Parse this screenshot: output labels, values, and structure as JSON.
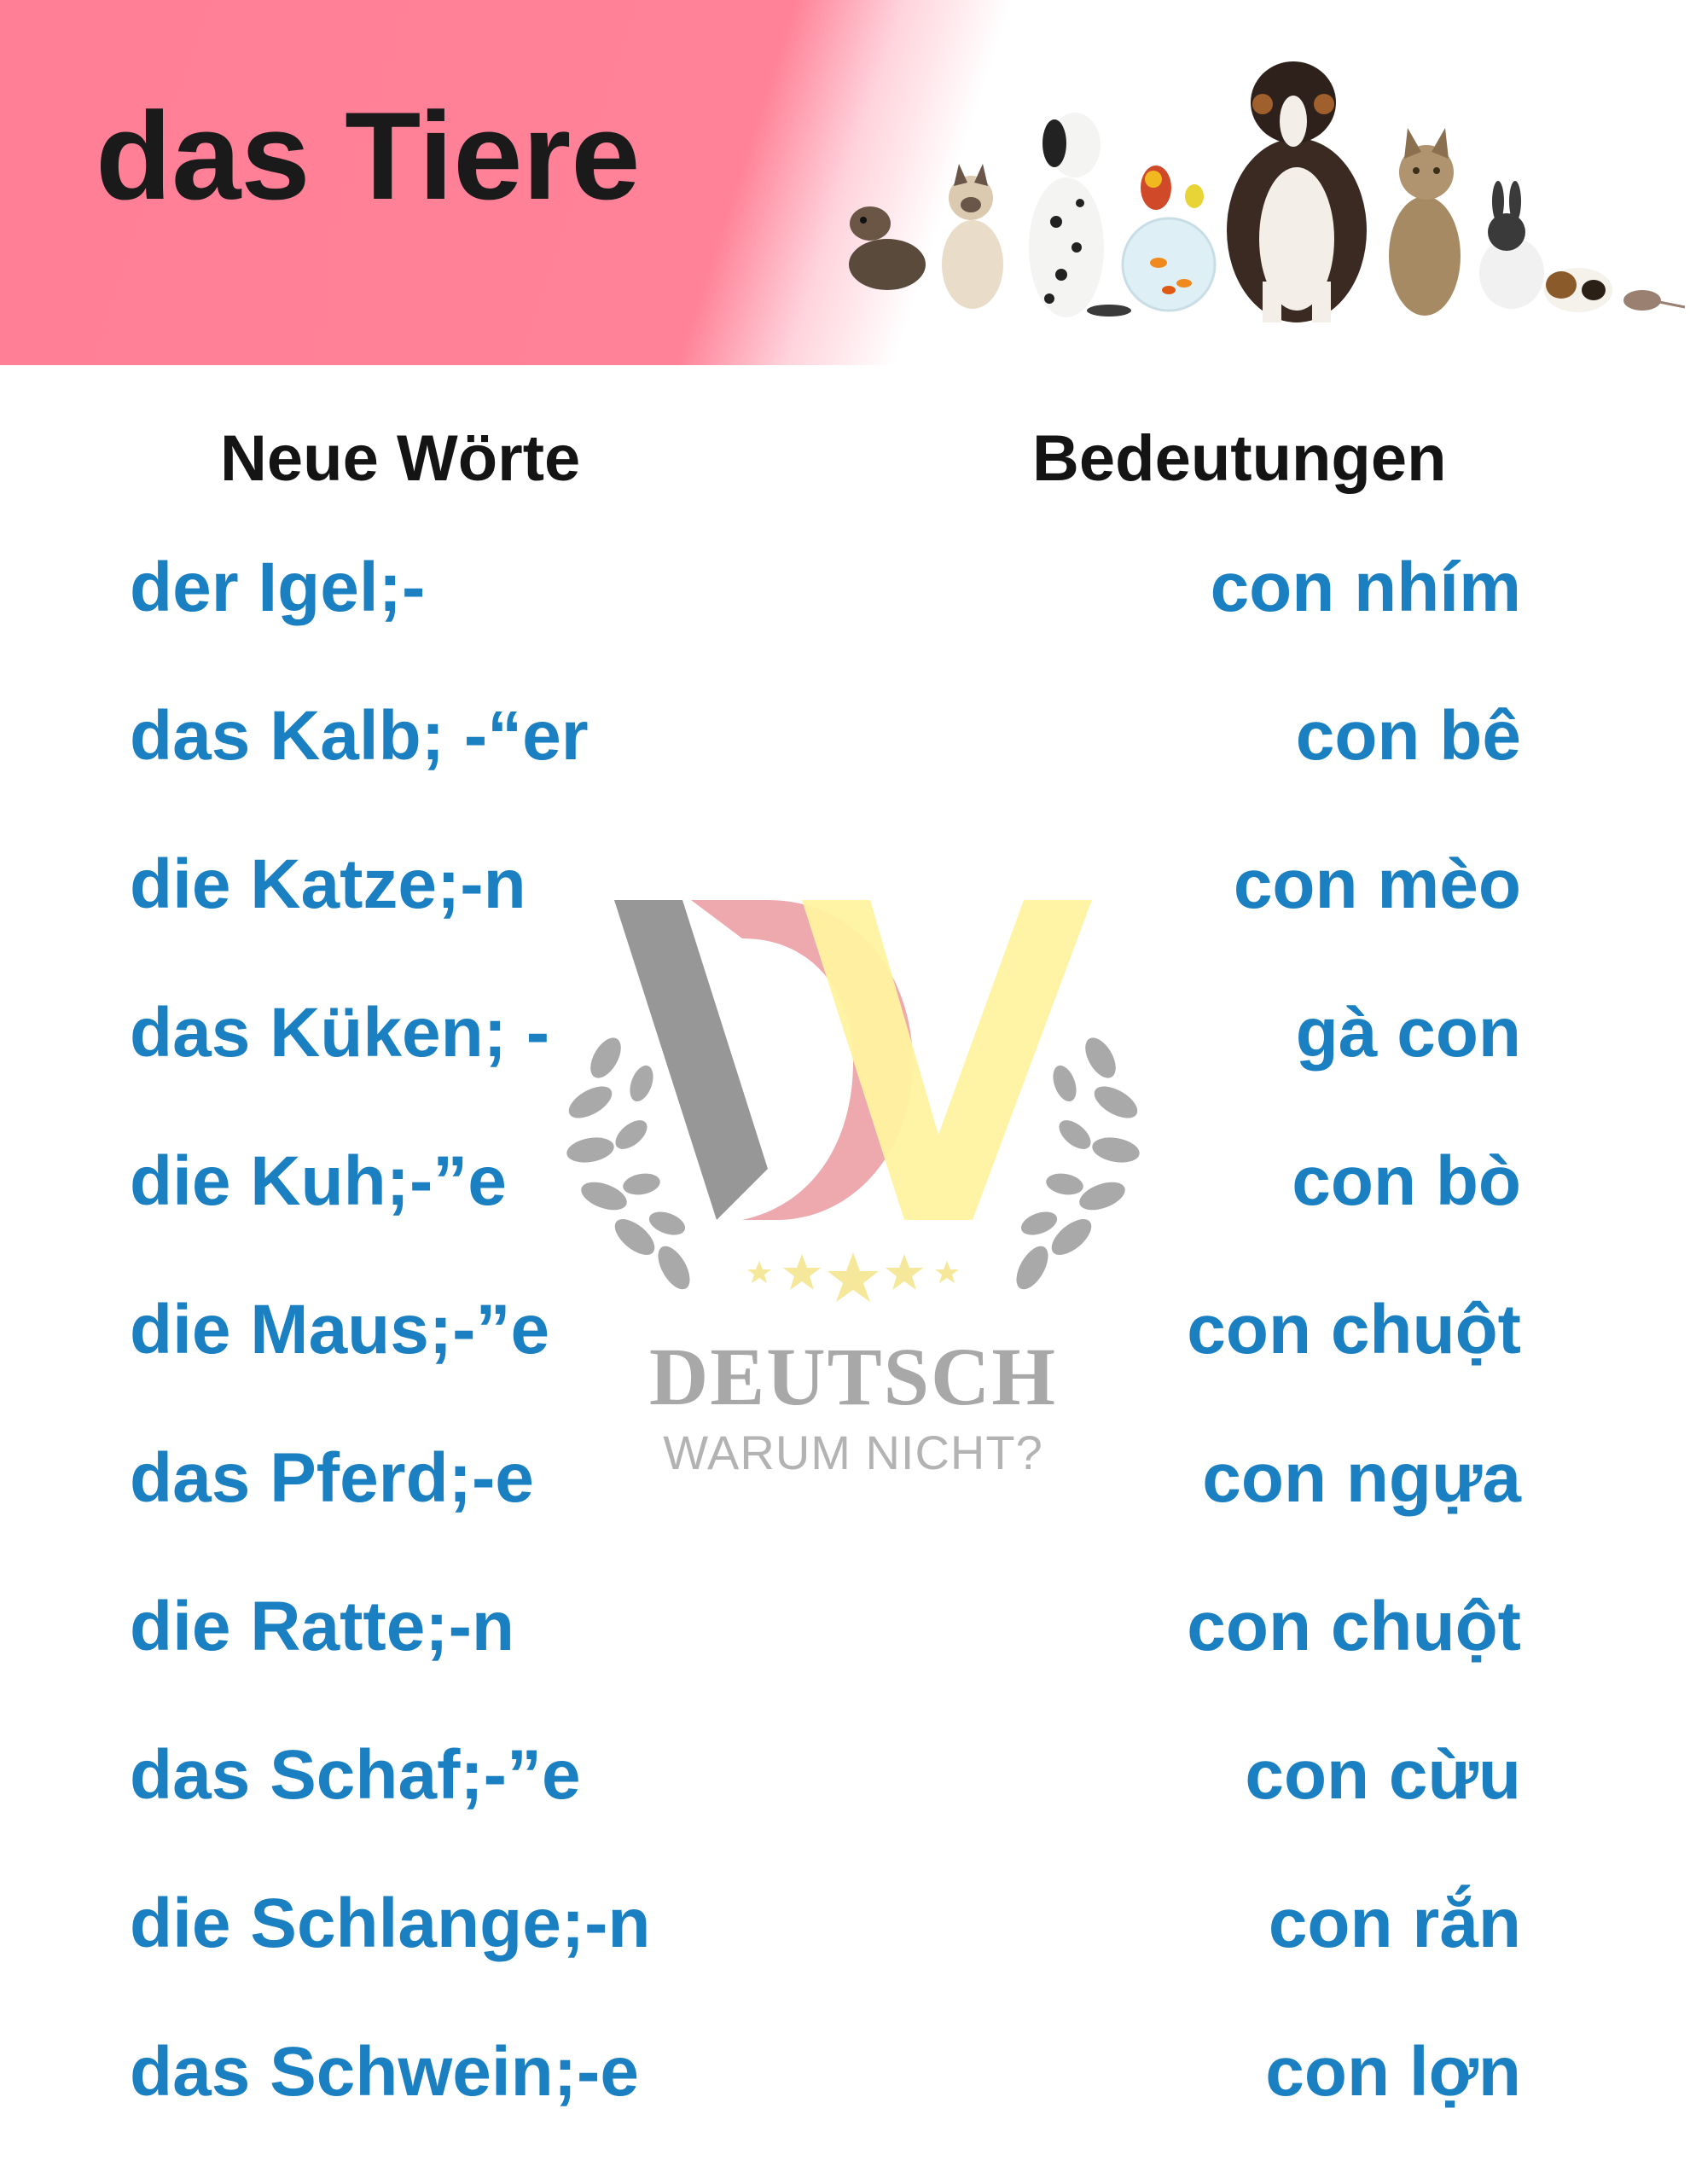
{
  "header": {
    "title": "das Tiere",
    "image": "pets-group-photo"
  },
  "columns": {
    "left_header": "Neue Wörte",
    "right_header": "Bedeutungen"
  },
  "vocabulary": [
    {
      "word": "der Igel;-",
      "meaning": "con nhím"
    },
    {
      "word": "das Kalb; -“er",
      "meaning": "con bê"
    },
    {
      "word": "die Katze;-n",
      "meaning": "con mèo"
    },
    {
      "word": "das Küken; -",
      "meaning": "gà con"
    },
    {
      "word": "die Kuh;-”e",
      "meaning": "con bò"
    },
    {
      "word": "die Maus;-”e",
      "meaning": "con chuột"
    },
    {
      "word": "das Pferd;-e",
      "meaning": "con ngựa"
    },
    {
      "word": "die Ratte;-n",
      "meaning": "con chuột"
    },
    {
      "word": "das Schaf;-”e",
      "meaning": "con cừu"
    },
    {
      "word": "die Schlange;-n",
      "meaning": "con rắn"
    },
    {
      "word": "das Schwein;-e",
      "meaning": "con lợn"
    }
  ],
  "watermark": {
    "line1": "DEUTSCH",
    "line2": "WARUM NICHT?",
    "logo": "dv-laurel-logo-icon"
  },
  "colors": {
    "header_pink": "#ff7f96",
    "text_blue": "#1b80c2",
    "text_dark": "#141414"
  }
}
